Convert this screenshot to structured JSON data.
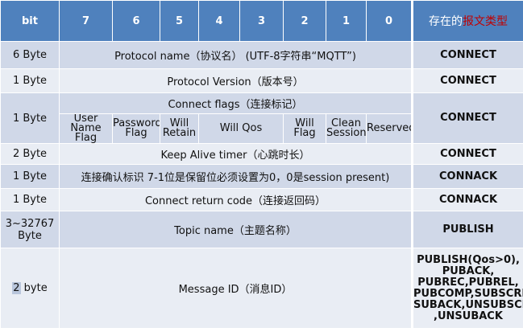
{
  "header": {
    "bit_label": "bit",
    "bits": [
      "7",
      "6",
      "5",
      "4",
      "3",
      "2",
      "1",
      "0"
    ],
    "type_label_prefix": "存在的",
    "type_label_red": "报文类型"
  },
  "rows": {
    "protocol_name": {
      "size": "6 Byte",
      "desc": "Protocol name（协议名）   (UTF-8字符串“MQTT”)",
      "type": "CONNECT"
    },
    "protocol_version": {
      "size": "1 Byte",
      "desc": "Protocol Version（版本号）",
      "type": "CONNECT"
    },
    "connect_flags": {
      "size": "1 Byte",
      "desc": "Connect flags（连接标记）",
      "type": "CONNECT",
      "flags": {
        "user_name": "User Name Flag",
        "password": "Password Flag",
        "will_retain": "Will Retain",
        "will_qos": "Will Qos",
        "will_flag": "Will Flag",
        "clean_session": "Clean Session",
        "reserved": "Reserved"
      }
    },
    "keep_alive": {
      "size": "2 Byte",
      "desc": "Keep Alive timer（心跳时长）",
      "type": "CONNECT"
    },
    "connack_flags": {
      "size": "1 Byte",
      "desc": "连接确认标识  7-1位是保留位必须设置为0，0是session present)",
      "type": "CONNACK"
    },
    "return_code": {
      "size": "1 Byte",
      "desc": "Connect return code（连接返回码）",
      "type": "CONNACK"
    },
    "topic_name": {
      "size_line1": "3~32767",
      "size_line2": "Byte",
      "desc": "Topic name（主题名称）",
      "type": "PUBLISH"
    },
    "message_id": {
      "size_num": "2",
      "size_unit": " byte",
      "desc": "Message ID（消息ID）",
      "types": [
        "PUBLISH(Qos>0),",
        "PUBACK,",
        "PUBREC,PUBREL,",
        "PUBCOMP,SUBSCRIBE,",
        "SUBACK,UNSUBSCRIBE",
        ",UNSUBACK"
      ]
    }
  },
  "colors": {
    "header": "#4f81bd",
    "row_dark": "#d0d8e8",
    "row_light": "#e9edf4",
    "type_red": "#c00000"
  }
}
